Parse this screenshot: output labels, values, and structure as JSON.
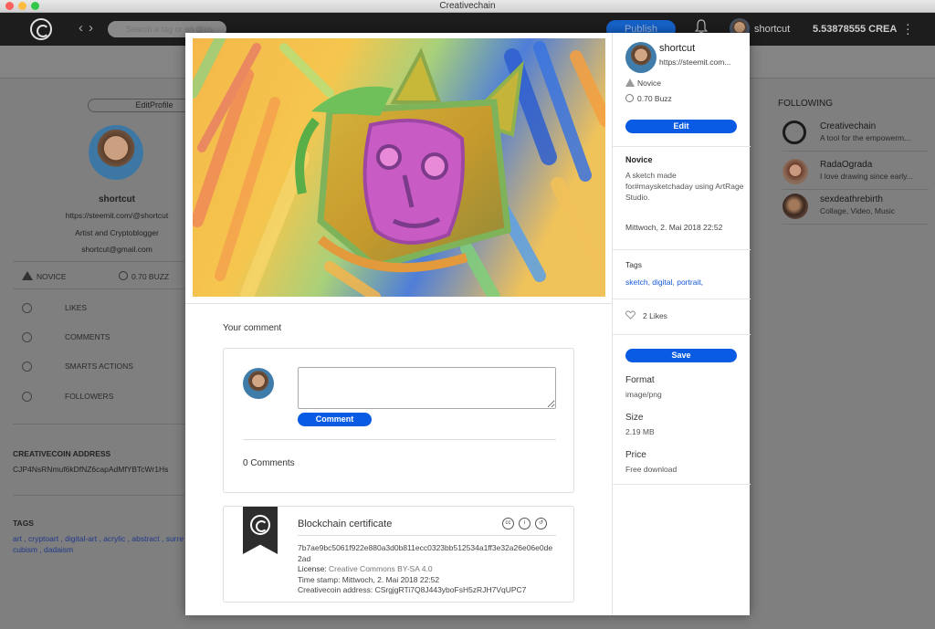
{
  "window": {
    "title": "Creativechain"
  },
  "header": {
    "search_placeholder": "Search a tag or an @us",
    "publish_label": "Publish",
    "username": "shortcut",
    "balance": "5.53878555 CREA"
  },
  "profile": {
    "edit_label": "EditProfile",
    "name": "shortcut",
    "url": "https://steemit.com/@shortcut",
    "bio": "Artist and Cryptoblogger",
    "email": "shortcut@gmail.com",
    "level": "NOVICE",
    "buzz": "0.70 BUZZ",
    "menu": [
      "LIKES",
      "COMMENTS",
      "SMARTS ACTIONS",
      "FOLLOWERS"
    ],
    "address_label": "CREATIVECOIN ADDRESS",
    "address": "CJP4NsRNmuf6kDfNZ6capAdMfYBTcWr1Hs",
    "tags_label": "TAGS",
    "tags": "art , cryptoart , digital-art , acrylic , abstract , surre cubism , dadaism"
  },
  "following": {
    "title": "FOLLOWING",
    "items": [
      {
        "name": "Creativechain",
        "desc": "A tool for the empowerm..."
      },
      {
        "name": "RadaOgrada",
        "desc": "I love drawing since early..."
      },
      {
        "name": "sexdeathrebirth",
        "desc": "Collage, Video, Music"
      }
    ]
  },
  "post": {
    "author": "shortcut",
    "author_url": "https://steemit.com...",
    "author_level": "Novice",
    "author_buzz": "0.70 Buzz",
    "edit_label": "Edit",
    "level_title": "Novice",
    "description": "A sketch made for#maysketchaday using ArtRage Studio.",
    "date": "Mittwoch, 2. Mai 2018 22:52",
    "tags_label": "Tags",
    "tags": "sketch, digital, portrait,",
    "likes": "2 Likes",
    "save_label": "Save",
    "format_label": "Format",
    "format_value": "image/png",
    "size_label": "Size",
    "size_value": "2.19 MB",
    "price_label": "Price",
    "price_value": "Free download"
  },
  "comments": {
    "heading": "Your comment",
    "button_label": "Comment",
    "count": "0 Comments"
  },
  "certificate": {
    "title": "Blockchain certificate",
    "hash": "7b7ae9bc5061f922e880a3d0b811ecc0323bb512534a1ff3e32a26e06e0de2ad",
    "license_label": "License:",
    "license_value": "Creative Commons BY-SA 4.0",
    "timestamp": "Time stamp: Mittwoch, 2. Mai 2018 22:52",
    "address": "Creativecoin address: CSrgjgRTi7Q8J443yboFsH5zRJH7VqUPC7"
  },
  "colors": {
    "accent": "#0a5be3",
    "header_bg": "#1d1d1d",
    "overlay": "#7f7f7f"
  }
}
